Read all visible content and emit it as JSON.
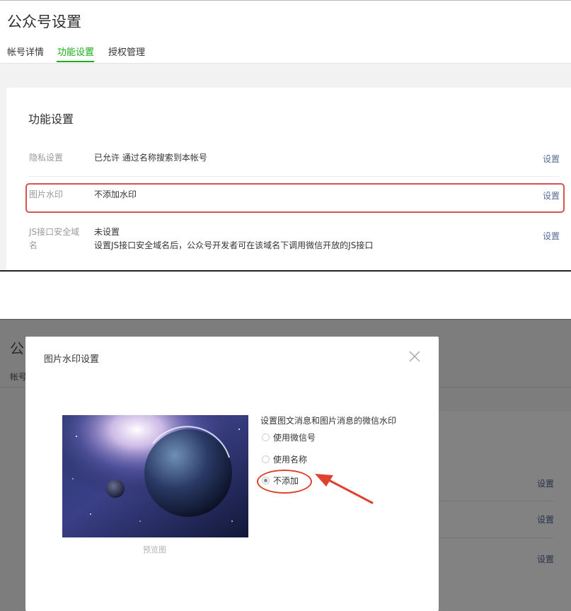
{
  "top": {
    "page_title": "公众号设置",
    "tabs": [
      {
        "label": "帐号详情",
        "active": false
      },
      {
        "label": "功能设置",
        "active": true
      },
      {
        "label": "授权管理",
        "active": false
      }
    ],
    "section_title": "功能设置",
    "rows": [
      {
        "label": "隐私设置",
        "value": "已允许 通过名称搜索到本帐号",
        "action": "设置"
      },
      {
        "label": "图片水印",
        "value": "不添加水印",
        "action": "设置",
        "highlighted": true
      },
      {
        "label_line1": "JS接口安全域",
        "label_line2": "名",
        "value": "未设置",
        "value_line2": "设置JS接口安全域名后，公众号开发者可在该域名下调用微信开放的JS接口",
        "action": "设置"
      }
    ]
  },
  "bottom": {
    "background": {
      "title_fragment": "公",
      "tab_fragment": "帐号",
      "links": [
        "设置",
        "设置",
        "设置"
      ]
    },
    "dialog": {
      "title": "图片水印设置",
      "close_icon": "close-icon",
      "preview_caption": "预览图",
      "options_heading": "设置图文消息和图片消息的微信水印",
      "options": [
        {
          "label": "使用微信号",
          "selected": false
        },
        {
          "label": "使用名称",
          "selected": false
        },
        {
          "label": "不添加",
          "selected": true
        }
      ]
    }
  },
  "colors": {
    "accent_green": "#1aad19",
    "link_blue": "#576b95",
    "annotation_red": "#d9534f",
    "overlay_gray": "#7d7d7d"
  }
}
